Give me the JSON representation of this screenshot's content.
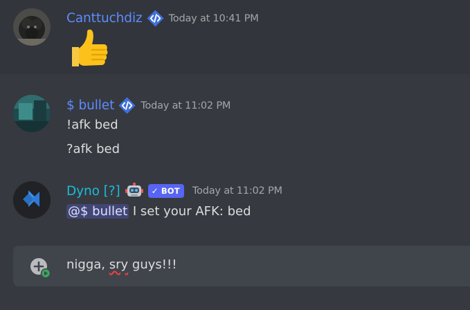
{
  "colors": {
    "background": "#36393f",
    "username_blue": "#5e8bff",
    "dyno_cyan": "#1abcdd",
    "mention_bg": "#414675",
    "bot_badge": "#5865f2"
  },
  "messages": [
    {
      "username": "Canttuchdiz",
      "badge": "developer-badge-icon",
      "timestamp": "Today at 10:41 PM",
      "lines": [
        "👍"
      ]
    },
    {
      "username": "$ bullet",
      "badge": "developer-badge-icon",
      "timestamp": "Today at 11:02 PM",
      "lines": [
        "!afk bed",
        "?afk bed"
      ]
    },
    {
      "username": "Dyno [?]",
      "emoji": "robot-icon",
      "bot_label": "BOT",
      "bot_check": "✓",
      "timestamp": "Today at 11:02 PM",
      "mention": "@$ bullet",
      "text": " I set your AFK: bed"
    }
  ],
  "composer": {
    "text_before": "nigga, ",
    "misspelled": "sry",
    "text_after": " guys!!!"
  }
}
